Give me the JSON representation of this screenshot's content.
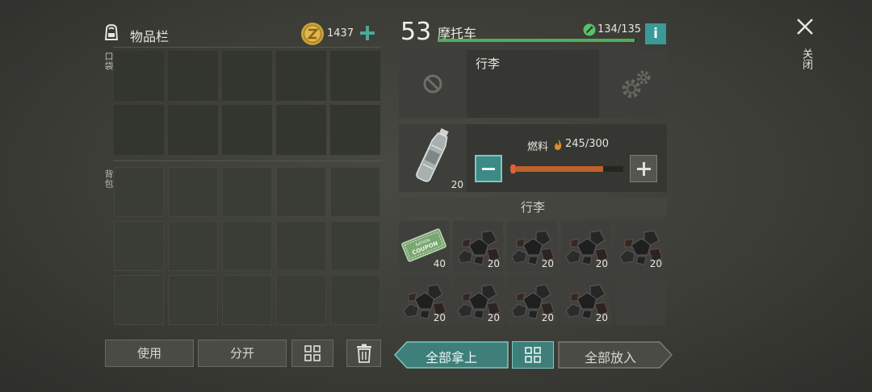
{
  "inventory": {
    "title": "物品栏",
    "icon": "backpack-icon",
    "coins": "1437",
    "pocket_label": "口袋",
    "backpack_label": "背包"
  },
  "vehicle": {
    "level": "53",
    "name": "摩托车",
    "durability": "134/135",
    "durability_fraction": 0.99,
    "cargo_title": "行李",
    "fuel_label": "燃料",
    "fuel_value": "245/300",
    "fuel_fraction": 0.82,
    "fuel_item_qty": "20",
    "cargo_header": "行李"
  },
  "cargo": [
    {
      "icon": "coupon-icon",
      "qty": "40",
      "text": "RATION COUPON"
    },
    {
      "icon": "coal-icon",
      "qty": "20"
    },
    {
      "icon": "coal-icon",
      "qty": "20"
    },
    {
      "icon": "coal-icon",
      "qty": "20"
    },
    {
      "icon": "coal-icon",
      "qty": "20"
    },
    {
      "icon": "coal-icon",
      "qty": "20"
    },
    {
      "icon": "coal-icon",
      "qty": "20"
    },
    {
      "icon": "coal-icon",
      "qty": "20"
    },
    {
      "icon": "coal-icon",
      "qty": "20"
    }
  ],
  "buttons": {
    "use": "使用",
    "split": "分开",
    "take_all": "全部拿上",
    "put_all": "全部放入"
  },
  "close_label": "关闭",
  "colors": {
    "accent": "#5fa8a0",
    "durability_bar": "#4fae5a",
    "fuel_bar": "#c0602a",
    "info": "#3a9a96"
  }
}
